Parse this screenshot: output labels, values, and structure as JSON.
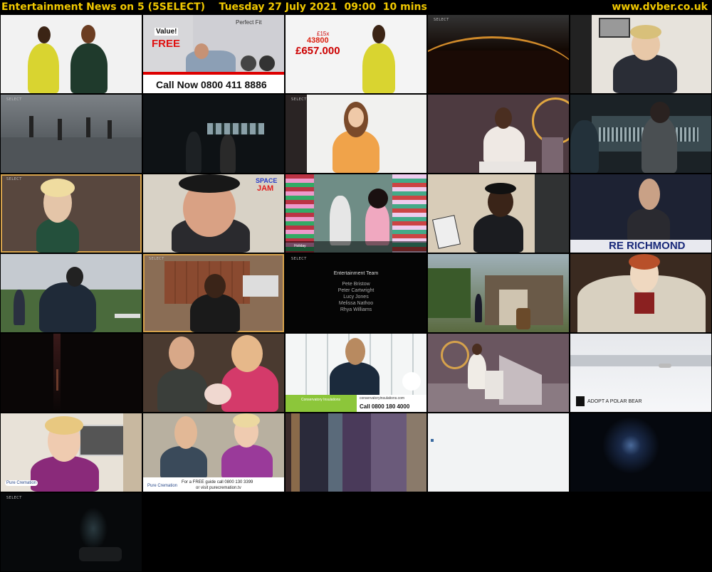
{
  "header": {
    "title": "Entertainment News on 5 (5SELECT)    Tuesday 27 July 2021  09:00  10 mins",
    "site": "www.dvber.co.uk"
  },
  "thumbs": {
    "t2": {
      "value": "Value!",
      "free": "FREE",
      "brand": "Perfect Fit",
      "call": "Call Now 0800 411 8886"
    },
    "t3": {
      "small": "£15x",
      "red": "43800",
      "big": "£657.000"
    },
    "t12": {
      "title1": "SPACE",
      "title2": "JAM"
    },
    "t13": {
      "caption": "Holiday"
    },
    "t15": {
      "banner": "RE RICHMOND"
    },
    "t18": {
      "heading": "Entertainment Team",
      "names": [
        "Pete Bristow",
        "Peter Cartwright",
        "Lucy Jones",
        "Melissa Nathoo",
        "Rhya Williams"
      ]
    },
    "t23": {
      "brand": "Conservatory Insulations",
      "call": "Call 0800 180 4000",
      "url": "conservatoryinsulations.com"
    },
    "t25": {
      "caption": "ADOPT A POLAR BEAR"
    },
    "t26": {
      "brand": "Pure Cremation"
    },
    "t27": {
      "brand": "Pure Cremation",
      "line1": "For a FREE guide call 0800 130 3399",
      "line2": "or visit purecremation.tv"
    }
  }
}
